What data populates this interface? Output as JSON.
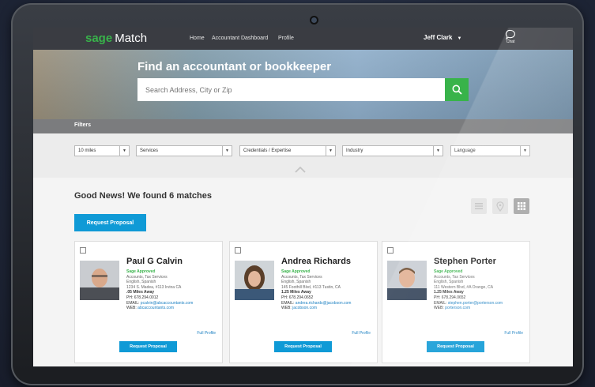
{
  "nav": {
    "logo_sage": "sage",
    "logo_match": "Match",
    "links": [
      "Home",
      "Accountant Dashboard",
      "Profile"
    ],
    "user": "Jeff Clark",
    "chat_label": "Chat"
  },
  "hero": {
    "title": "Find an accountant or bookkeeper",
    "search_placeholder": "Search Address, City or Zip"
  },
  "filters": {
    "label": "Filters",
    "selects": [
      "10 miles",
      "Services",
      "Credentials / Expertise",
      "Industry",
      "Language"
    ]
  },
  "results": {
    "title": "Good News! We found 6 matches",
    "request_label": "Request Proposal"
  },
  "cards": [
    {
      "name": "Paul G Calvin",
      "approved": "Sage Approved",
      "services": "Accounts, Tax Services",
      "languages": "English, Spanish",
      "address": "1234 S. Madea, #113 Irvina CA",
      "distance": ".05 Miles Away",
      "ph_label": "PH:",
      "phone": "678.294.0012",
      "email_label": "EMAIL:",
      "email": "pcalvin@abcaccountants.com",
      "web_label": "WEB:",
      "web": "abcaccountants.com",
      "full_profile": "Full Profile",
      "button": "Request Proposal"
    },
    {
      "name": "Andrea Richards",
      "approved": "Sage Approved",
      "services": "Accounts, Tax Services",
      "languages": "English, Spanish",
      "address": "145 Foothill Blvd, #113 Tustin, CA",
      "distance": "1.25 Miles Away",
      "ph_label": "PH:",
      "phone": "678.294.0652",
      "email_label": "EMAIL:",
      "email": "andrea.richards@jacobson.com",
      "web_label": "WEB:",
      "web": "jacobson.com",
      "full_profile": "Full Profile",
      "button": "Request Proposal"
    },
    {
      "name": "Stephen Porter",
      "approved": "Sage Approved",
      "services": "Accounts, Tax Services",
      "languages": "English, Spanish",
      "address": "111 Western Blvd, #A Orange, CA",
      "distance": "1.25 Miles Away",
      "ph_label": "PH:",
      "phone": "678.294.0652",
      "email_label": "EMAIL:",
      "email": "stephen.porter@porterson.com",
      "web_label": "WEB:",
      "web": "porterson.com",
      "full_profile": "Full Profile",
      "button": "Request Proposal"
    }
  ],
  "icons": {
    "search": "search-icon",
    "chat": "chat-bubble-icon",
    "list_view": "list-view-icon",
    "map_view": "map-pin-icon",
    "grid_view": "grid-view-icon",
    "collapse": "chevron-up-icon"
  },
  "colors": {
    "brand_green": "#38b34a",
    "accent_blue": "#0f9ad6",
    "nav_bg": "#3a3c42"
  }
}
